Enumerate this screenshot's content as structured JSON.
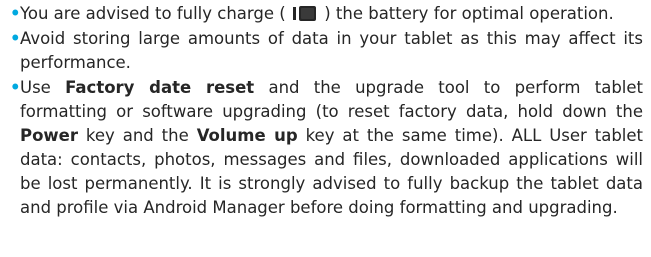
{
  "bullet_symbol": "•",
  "bullet_color": "#00a9e0",
  "items": [
    {
      "before": "You are advised to fully charge (",
      "icon": "battery-full-icon",
      "after": ") the battery for optimal operation."
    },
    {
      "text": "Avoid storing large amounts of data in your tablet as this may affect its performance."
    },
    {
      "t1": "Use ",
      "b1": "Factory date reset",
      "t2": " and the upgrade tool to perform tablet formatting or software upgrading (to reset factory data, hold down the ",
      "b2": "Power",
      "t3": " key and the ",
      "b3": "Volume up",
      "t4": " key at the same time). ALL User tablet data: contacts, photos, messages and files, downloaded applications will be lost permanently. It is strongly advised to fully backup the tablet data and profile via Android Manager before doing formatting and upgrading."
    }
  ]
}
